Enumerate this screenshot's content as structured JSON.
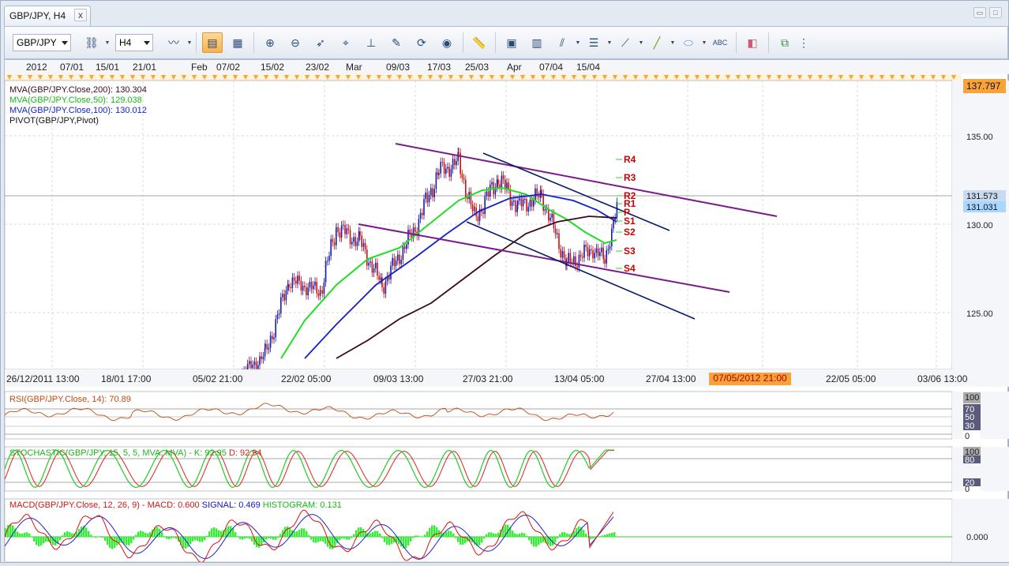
{
  "window": {
    "tab_title": "GBP/JPY, H4",
    "close_glyph": "x"
  },
  "toolbar": {
    "symbol": "GBP/JPY",
    "timeframe": "H4",
    "icons": [
      "candle-icon",
      "link-icon",
      "chart-style-icon",
      "bar-chart-icon",
      "table-icon",
      "zoom-in-icon",
      "zoom-out-icon",
      "cursor-icon",
      "crosshair-icon",
      "indicator-icon",
      "edit-icon",
      "sync-icon",
      "globe-icon",
      "ruler-icon",
      "picture-icon",
      "template-icon",
      "line-tools-icon",
      "horizontal-line-icon",
      "fibonacci-icon",
      "trendline-icon",
      "ellipse-icon",
      "text-icon",
      "eraser-icon",
      "tree-icon"
    ]
  },
  "time_axis_top": [
    "2012",
    "07/01",
    "15/01",
    "21/01",
    "Feb",
    "07/02",
    "15/02",
    "23/02",
    "Mar",
    "09/03",
    "17/03",
    "25/03",
    "Apr",
    "07/04",
    "15/04"
  ],
  "time_axis_bottom": [
    "26/12/2011 13:00",
    "18/01 17:00",
    "05/02 21:00",
    "22/02 05:00",
    "09/03 13:00",
    "27/03 21:00",
    "13/04 05:00",
    "27/04 13:00",
    "07/05/2012 21:00",
    "22/05 05:00",
    "03/06 13:00"
  ],
  "price_axis": {
    "labels": [
      "135.00",
      "130.00",
      "125.00"
    ],
    "top_badge": "137.797",
    "current_badges": [
      "131.573",
      "131.031"
    ]
  },
  "legend": {
    "ma200": "MVA(GBP/JPY.Close,200): 130.304",
    "ma50": "MVA(GBP/JPY.Close,50): 129.038",
    "ma100": "MVA(GBP/JPY.Close,100): 130.012",
    "pivot": "PIVOT(GBP/JPY,Pivot)"
  },
  "pivot_levels": [
    "R4",
    "R3",
    "R2",
    "R1",
    "P",
    "S1",
    "S2",
    "S3",
    "S4"
  ],
  "rsi": {
    "label": "RSI(GBP/JPY.Close, 14): 70.89",
    "axis": [
      "100",
      "70",
      "50",
      "30",
      "0"
    ]
  },
  "stochastic": {
    "label": "STOCHASTIC(GBP/JPY, 15, 5, 5, MVA, MVA) - K: 92.95",
    "d_label": "D: 92.94",
    "axis": [
      "100",
      "80",
      "20",
      "0"
    ]
  },
  "macd": {
    "label": "MACD(GBP/JPY.Close, 12, 26, 9) - MACD: 0.600",
    "signal": "SIGNAL: 0.469",
    "histogram": "HISTOGRAM: 0.131",
    "axis": "0.000"
  },
  "colors": {
    "ma200": "#3a0a18",
    "ma50": "#22dd22",
    "ma100": "#1122cc",
    "pivot_text": "#cc0000",
    "channel_purple": "#7a1a8a",
    "channel_navy": "#0a1a6a",
    "badge_orange": "#f7a33a",
    "badge_blue": "#a8d8ff"
  }
}
